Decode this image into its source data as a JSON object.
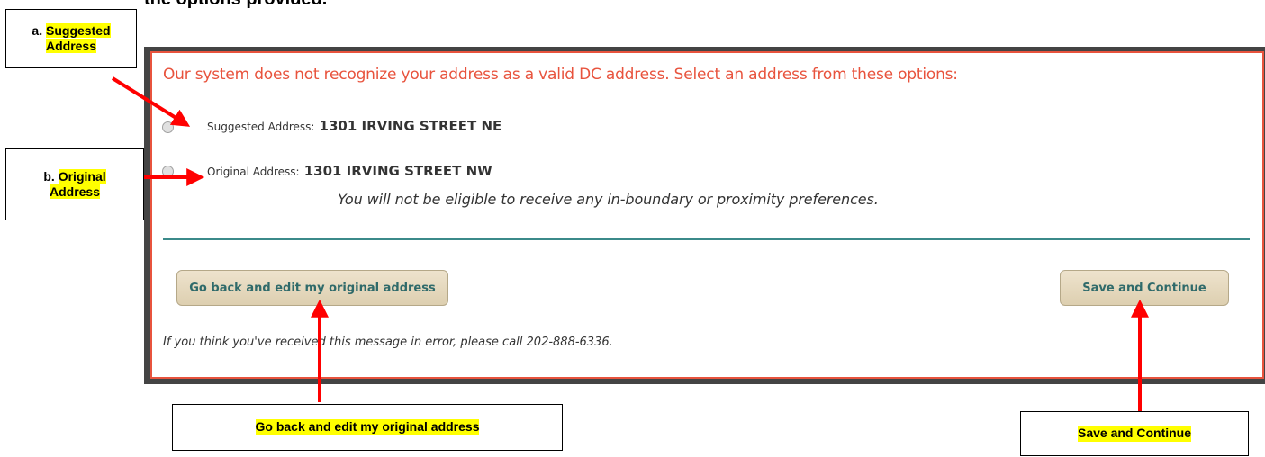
{
  "instruction_fragment": "the options provided.",
  "callouts": {
    "suggested": {
      "prefix": "a.",
      "line1": "Suggested",
      "line2": "Address"
    },
    "original": {
      "prefix": "b.",
      "line1": "Original",
      "line2": "Address"
    },
    "go_back": {
      "text": "Go back and edit my original address"
    },
    "save": {
      "text": "Save and Continue"
    }
  },
  "dialog": {
    "error_message": "Our system does not recognize your address as a valid DC address. Select an address from these options:",
    "options": [
      {
        "label": "Suggested Address:",
        "value": "1301 IRVING STREET NE"
      },
      {
        "label": "Original Address:",
        "value": "1301 IRVING STREET NW"
      }
    ],
    "warning": "You will not be eligible to receive any in-boundary or proximity preferences.",
    "buttons": {
      "go_back": "Go back and edit my original address",
      "save": "Save and Continue"
    },
    "footer_note": "If you think you've received this message in error, please call 202-888-6336."
  },
  "colors": {
    "error_red": "#e8533d",
    "button_text": "#2f6a6a",
    "divider": "#3b8a8a",
    "arrow": "#ff0000",
    "highlight": "#ffff00"
  }
}
